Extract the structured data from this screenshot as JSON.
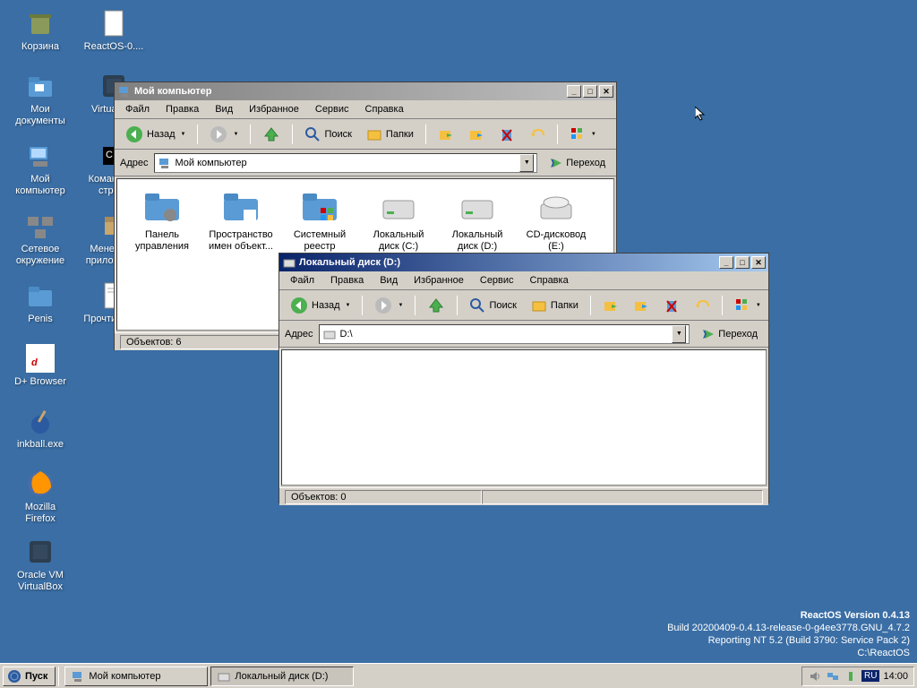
{
  "desktop_icons": [
    {
      "label": "Корзина"
    },
    {
      "label": "ReactOS-0...."
    },
    {
      "label": "Мои документы"
    },
    {
      "label": "VirtualBox"
    },
    {
      "label": "Мой компьютер"
    },
    {
      "label": "Командная строка"
    },
    {
      "label": "Сетевое окружение"
    },
    {
      "label": "Менеджер приложений"
    },
    {
      "label": "Penis"
    },
    {
      "label": "Прочти Меня"
    },
    {
      "label": "D+ Browser"
    },
    {
      "label": "inkball.exe"
    },
    {
      "label": "Mozilla Firefox"
    },
    {
      "label": "Oracle VM VirtualBox"
    }
  ],
  "win1": {
    "title": "Мой компьютер",
    "menu": [
      "Файл",
      "Правка",
      "Вид",
      "Избранное",
      "Сервис",
      "Справка"
    ],
    "back": "Назад",
    "search": "Поиск",
    "folders": "Папки",
    "address_label": "Адрес",
    "address_value": "Мой компьютер",
    "go": "Переход",
    "items": [
      "Панель управления",
      "Пространство имен объект...",
      "Системный реестр",
      "Локальный диск (C:)",
      "Локальный диск (D:)",
      "CD-дисковод (E:)"
    ],
    "status": "Объектов: 6"
  },
  "win2": {
    "title": "Локальный диск (D:)",
    "menu": [
      "Файл",
      "Правка",
      "Вид",
      "Избранное",
      "Сервис",
      "Справка"
    ],
    "back": "Назад",
    "search": "Поиск",
    "folders": "Папки",
    "address_label": "Адрес",
    "address_value": "D:\\",
    "go": "Переход",
    "status": "Объектов: 0"
  },
  "taskbar": {
    "start": "Пуск",
    "task1": "Мой компьютер",
    "task2": "Локальный диск (D:)",
    "lang": "RU",
    "time": "14:00"
  },
  "build": {
    "l1": "ReactOS Version 0.4.13",
    "l2": "Build 20200409-0.4.13-release-0-g4ee3778.GNU_4.7.2",
    "l3": "Reporting NT 5.2 (Build 3790: Service Pack 2)",
    "l4": "C:\\ReactOS"
  }
}
